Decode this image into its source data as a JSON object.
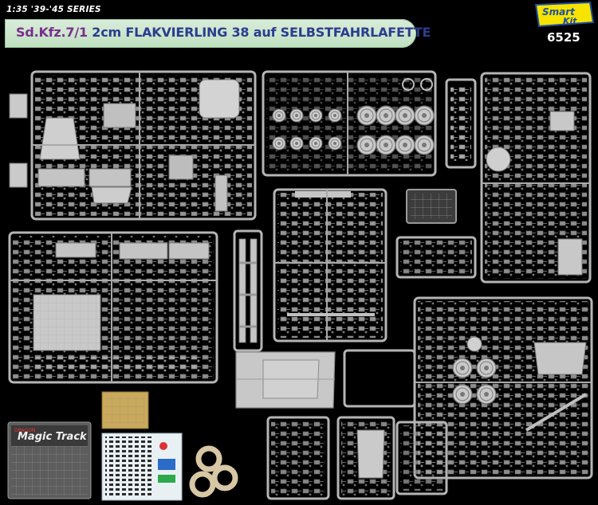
{
  "header": {
    "series": "1:35 '39-'45 SERIES",
    "title_part_1": "Sd.Kfz.7/1",
    "title_part_2": "2cm FLAKVIERLING 38 auf SELBSTFAHRLAFETTE",
    "kit_number": "6525"
  },
  "brand": {
    "logo_text": "Smart Kit",
    "icon": "smart-kit-logo"
  },
  "accessories": {
    "bag_label": "Magic Track",
    "bag_maker": "DRAGON"
  },
  "colors": {
    "background": "#000000",
    "sprue_grey": "#b8b8b8",
    "banner_green": "#c8e6c9",
    "title_purple": "#7a2f8f",
    "title_blue": "#2a3d8f",
    "logo_yellow": "#f6e300",
    "logo_blue": "#1d4fa0",
    "photo_etch": "#c9a95b"
  }
}
